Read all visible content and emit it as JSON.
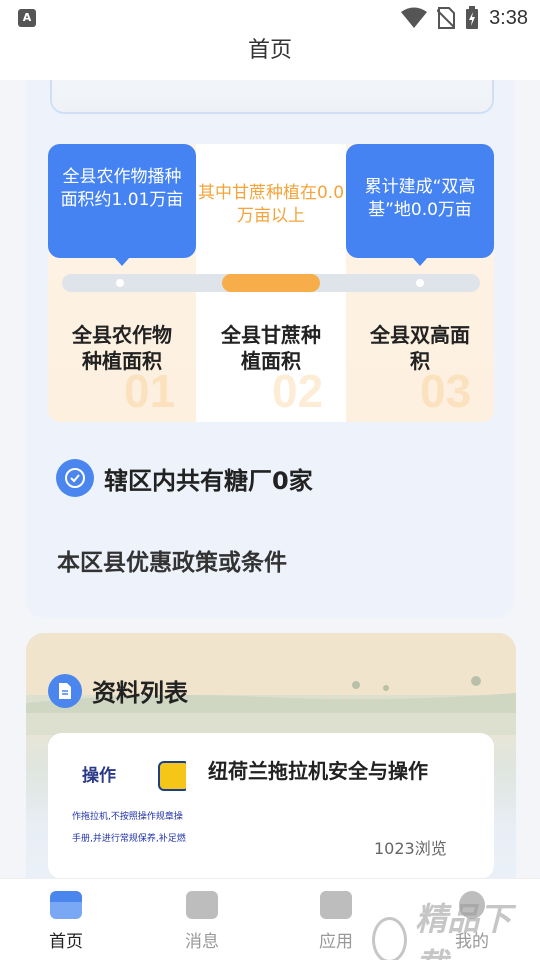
{
  "status_bar": {
    "time": "3:38",
    "left_icon": "A"
  },
  "header": {
    "title": "首页"
  },
  "stats": [
    {
      "bubble": "全县农作物播种面积约1.01万亩",
      "label": "全县农作物种植面积",
      "num": "01"
    },
    {
      "bubble": "其中甘蔗种植在0.0万亩以上",
      "label": "全县甘蔗种植面积",
      "num": "02"
    },
    {
      "bubble": "累计建成“双高基”地0.0万亩",
      "label": "全县双高面积",
      "num": "03"
    }
  ],
  "factory_text": "辖区内共有糖厂0家",
  "policy_text": "本区县优惠政策或条件",
  "list": {
    "title": "资料列表",
    "items": [
      {
        "title": "纽荷兰拖拉机安全与操作",
        "views": "1023浏览",
        "thumb_caption": "操作",
        "thumb_line1": "作拖拉机,不按照操作规章操",
        "thumb_line2": "手册,并进行常规保养,补足燃"
      }
    ]
  },
  "tabs": [
    {
      "label": "首页",
      "active": true
    },
    {
      "label": "消息",
      "active": false
    },
    {
      "label": "应用",
      "active": false
    },
    {
      "label": "我的",
      "active": false
    }
  ],
  "watermark": {
    "text": "精品下载"
  },
  "colors": {
    "accent_blue": "#4583f2",
    "accent_orange": "#f7ad49"
  }
}
